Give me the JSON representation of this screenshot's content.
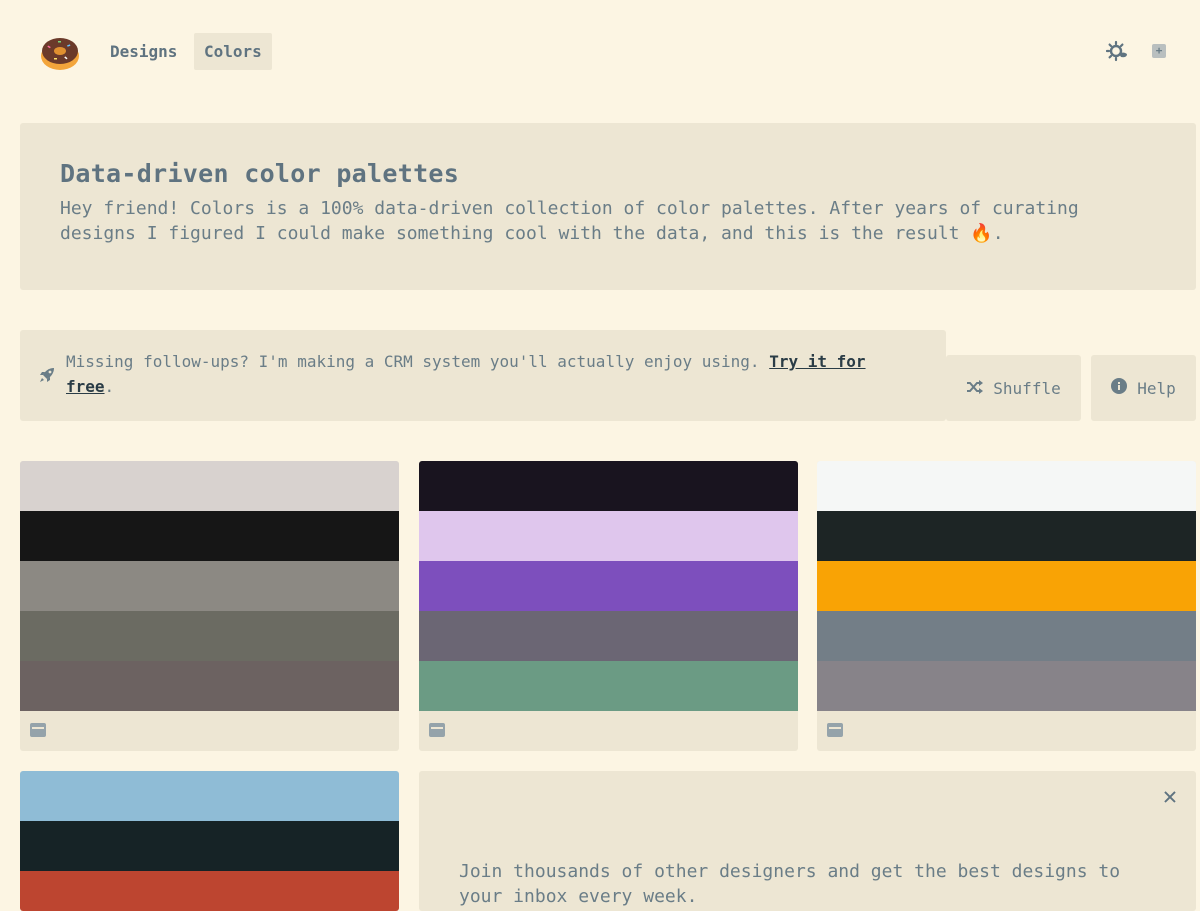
{
  "nav": {
    "logo": "🍩",
    "links": [
      {
        "label": "Designs",
        "active": false
      },
      {
        "label": "Colors",
        "active": true
      }
    ],
    "icons": [
      "theme-toggle-icon",
      "plus-icon"
    ]
  },
  "hero": {
    "title": "Data-driven color palettes",
    "body": "Hey friend! Colors is a 100% data-driven collection of color palettes. After years of curating designs I figured I could make something cool with the data, and this is the result 🔥."
  },
  "promo": {
    "text": "Missing follow-ups? I'm making a CRM system you'll actually enjoy using. ",
    "link": "Try it for free",
    "suffix": "."
  },
  "buttons": {
    "shuffle": "Shuffle",
    "help": "Help"
  },
  "palettes": [
    {
      "colors": [
        "#d8d2cf",
        "#161616",
        "#8c8983",
        "#6b6b62",
        "#6c6261"
      ]
    },
    {
      "colors": [
        "#19141f",
        "#dfc6ed",
        "#7d4fbd",
        "#6b6674",
        "#6b9b84"
      ]
    },
    {
      "colors": [
        "#f5f7f6",
        "#1d2525",
        "#f9a305",
        "#737e87",
        "#878389"
      ]
    }
  ],
  "partial_palette": {
    "colors": [
      "#8fbcd6",
      "#162326",
      "#bd4530"
    ]
  },
  "newsletter": {
    "close": "✕",
    "text": "Join thousands of other designers and get the best designs to your inbox every week."
  }
}
